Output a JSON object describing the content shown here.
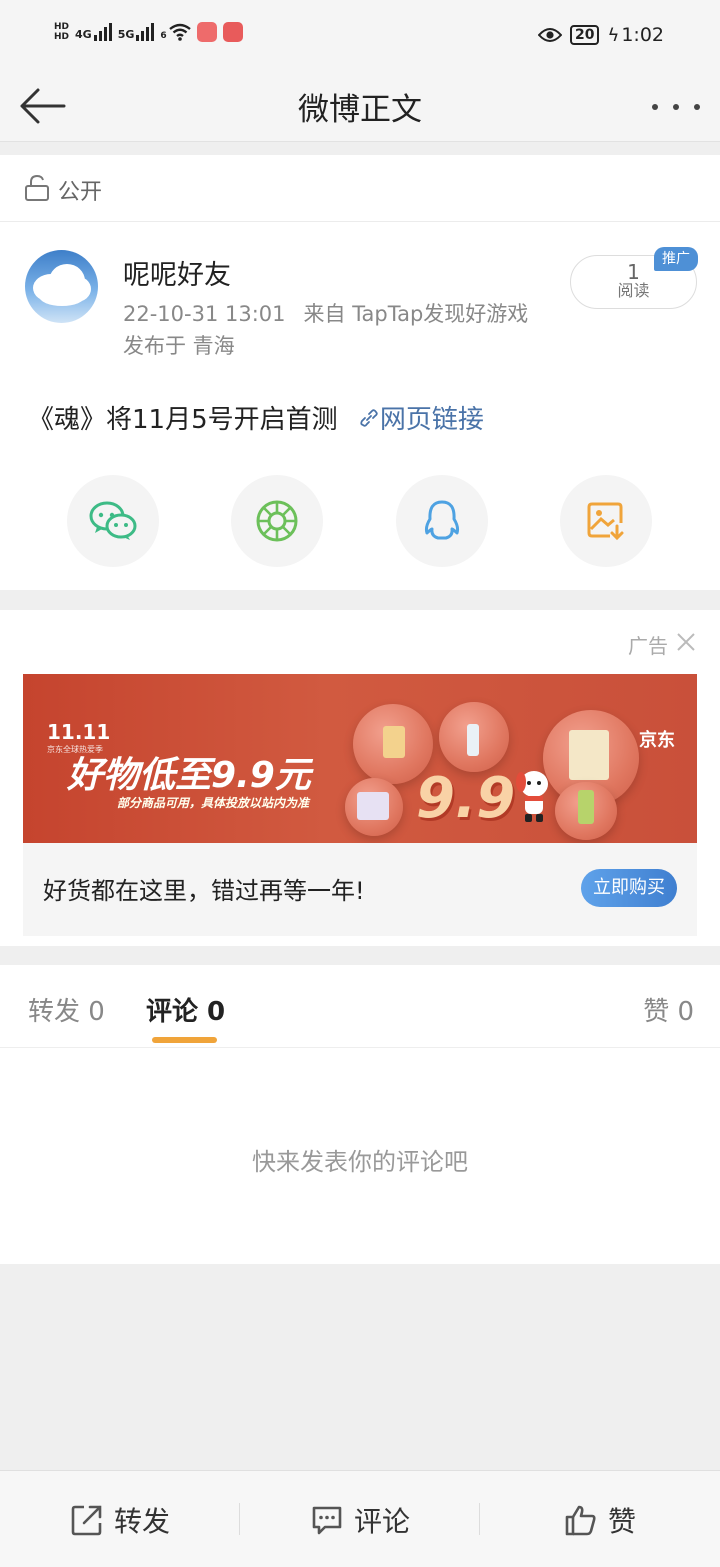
{
  "status_bar": {
    "hd_top": "HD",
    "hd_bottom": "HD",
    "net_1": "4G",
    "net_2": "5G",
    "wifi_sup": "6",
    "battery": "20",
    "time": "1:02"
  },
  "header": {
    "title": "微博正文"
  },
  "post": {
    "visibility": "公开",
    "author": "呢呢好友",
    "timestamp": "22-10-31 13:01",
    "source": "来自 TapTap发现好游戏",
    "location": "发布于 青海",
    "read_count": "1",
    "read_label": "阅读",
    "promo_badge": "推广",
    "text": "《魂》将11月5号开启首测",
    "link_text": "网页链接",
    "share_targets": [
      "wechat-icon",
      "moments-icon",
      "qq-icon",
      "save-image-icon"
    ]
  },
  "ad": {
    "label": "广告",
    "banner": {
      "event": "11.11",
      "event_sub": "京东全球热爱季",
      "headline": "好物低至9.9元",
      "subline": "部分商品可用，具体投放以站内为准",
      "big_price": "9.9",
      "brand": "京东"
    },
    "slogan": "好货都在这里，错过再等一年!",
    "cta": "立即购买"
  },
  "tabs": {
    "repost": "转发 0",
    "comment": "评论 0",
    "like": "赞 0",
    "active": "comment"
  },
  "comments": {
    "empty": "快来发表你的评论吧"
  },
  "bottom_bar": {
    "repost": "转发",
    "comment": "评论",
    "like": "赞"
  },
  "colors": {
    "link": "#4a73a8",
    "tab_indicator": "#f0a43a",
    "badge": "#4e90d6",
    "ad_banner": "#c5442e"
  }
}
